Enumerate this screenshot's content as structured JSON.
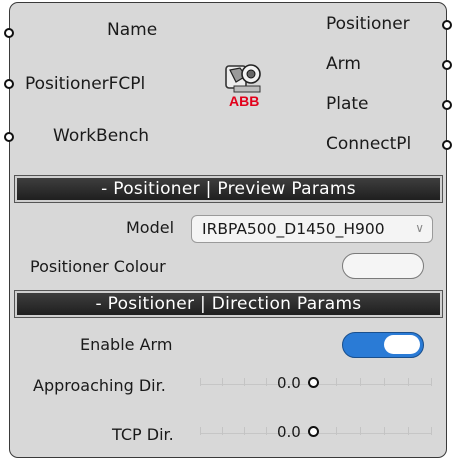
{
  "inputs": [
    {
      "label": "Name"
    },
    {
      "label": "PositionerFCPl"
    },
    {
      "label": "WorkBench"
    }
  ],
  "outputs": [
    {
      "label": "Positioner"
    },
    {
      "label": "Arm"
    },
    {
      "label": "Plate"
    },
    {
      "label": "ConnectPl"
    }
  ],
  "logo": {
    "text": "ABB",
    "icon": "robot-positioner-logo"
  },
  "preview_section": {
    "title": "- Positioner | Preview Params",
    "model_label": "Model",
    "model_value": "IRBPA500_D1450_H900",
    "colour_label": "Positioner Colour",
    "colour_value": "#f5f5f5"
  },
  "direction_section": {
    "title": "- Positioner | Direction Params",
    "enable_arm_label": "Enable Arm",
    "enable_arm": true,
    "approaching_label": "Approaching Dir.",
    "approaching_value": "0.0",
    "tcp_label": "TCP Dir.",
    "tcp_value": "0.0"
  },
  "colors": {
    "toggle_on": "#2a7bd6",
    "header_bg": "#2c2c2c",
    "node_bg": "#d8d8d8"
  }
}
